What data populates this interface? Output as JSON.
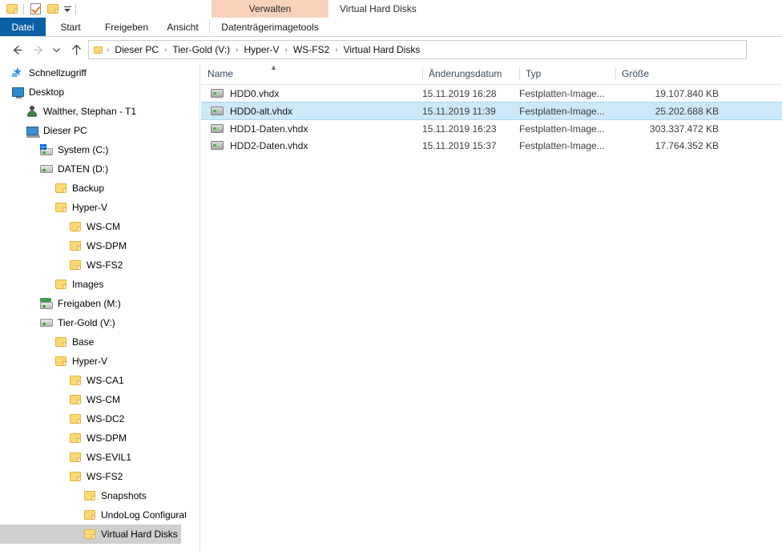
{
  "window": {
    "title": "Virtual Hard Disks",
    "contextual_tab_group": "Verwalten"
  },
  "quick_access_toolbar": {
    "items": [
      {
        "name": "folder-icon",
        "label": ""
      },
      {
        "name": "properties-icon",
        "label": ""
      },
      {
        "name": "new-folder-icon",
        "label": ""
      },
      {
        "name": "customize-dropdown-icon",
        "label": ""
      }
    ]
  },
  "ribbon": {
    "tabs": [
      {
        "id": "file",
        "label": "Datei"
      },
      {
        "id": "start",
        "label": "Start"
      },
      {
        "id": "share",
        "label": "Freigeben"
      },
      {
        "id": "view",
        "label": "Ansicht"
      },
      {
        "id": "disktools",
        "label": "Datenträgerimagetools"
      }
    ],
    "active_tab": "Datei"
  },
  "navigation": {
    "back_label": "Zurück",
    "forward_label": "Vorwärts",
    "recent_label": "Zuletzt besuchte Orte",
    "up_label": "Nach oben",
    "breadcrumb": [
      "Dieser PC",
      "Tier-Gold (V:)",
      "Hyper-V",
      "WS-FS2",
      "Virtual Hard Disks"
    ],
    "separator": "›"
  },
  "sidebar": {
    "items": [
      {
        "label": "Schnellzugriff",
        "icon": "star-icon",
        "indent": 0,
        "selected": false
      },
      {
        "label": "Desktop",
        "icon": "desktop-icon",
        "indent": 0,
        "selected": false
      },
      {
        "label": "Walther, Stephan - T1",
        "icon": "user-icon",
        "indent": 1,
        "selected": false
      },
      {
        "label": "Dieser PC",
        "icon": "pc-icon",
        "indent": 1,
        "selected": false
      },
      {
        "label": "System (C:)",
        "icon": "system-drive-icon",
        "indent": 2,
        "selected": false
      },
      {
        "label": "DATEN (D:)",
        "icon": "drive-icon",
        "indent": 2,
        "selected": false
      },
      {
        "label": "Backup",
        "icon": "folder-icon",
        "indent": 3,
        "selected": false
      },
      {
        "label": "Hyper-V",
        "icon": "folder-icon",
        "indent": 3,
        "selected": false
      },
      {
        "label": "WS-CM",
        "icon": "folder-icon",
        "indent": 4,
        "selected": false
      },
      {
        "label": "WS-DPM",
        "icon": "folder-icon",
        "indent": 4,
        "selected": false
      },
      {
        "label": "WS-FS2",
        "icon": "folder-icon",
        "indent": 4,
        "selected": false
      },
      {
        "label": "Images",
        "icon": "folder-icon",
        "indent": 3,
        "selected": false
      },
      {
        "label": "Freigaben (M:)",
        "icon": "network-drive-icon",
        "indent": 2,
        "selected": false
      },
      {
        "label": "Tier-Gold (V:)",
        "icon": "drive-icon",
        "indent": 2,
        "selected": false
      },
      {
        "label": "Base",
        "icon": "folder-icon",
        "indent": 3,
        "selected": false
      },
      {
        "label": "Hyper-V",
        "icon": "folder-icon",
        "indent": 3,
        "selected": false
      },
      {
        "label": "WS-CA1",
        "icon": "folder-icon",
        "indent": 4,
        "selected": false
      },
      {
        "label": "WS-CM",
        "icon": "folder-icon",
        "indent": 4,
        "selected": false
      },
      {
        "label": "WS-DC2",
        "icon": "folder-icon",
        "indent": 4,
        "selected": false
      },
      {
        "label": "WS-DPM",
        "icon": "folder-icon",
        "indent": 4,
        "selected": false
      },
      {
        "label": "WS-EVIL1",
        "icon": "folder-icon",
        "indent": 4,
        "selected": false
      },
      {
        "label": "WS-FS2",
        "icon": "folder-icon",
        "indent": 4,
        "selected": false
      },
      {
        "label": "Snapshots",
        "icon": "folder-icon",
        "indent": 5,
        "selected": false
      },
      {
        "label": "UndoLog Configuration",
        "icon": "folder-icon",
        "indent": 5,
        "selected": false
      },
      {
        "label": "Virtual Hard Disks",
        "icon": "folder-icon",
        "indent": 5,
        "selected": true
      }
    ]
  },
  "file_list": {
    "columns": [
      {
        "key": "name",
        "label": "Name",
        "sorted": "asc"
      },
      {
        "key": "date",
        "label": "Änderungsdatum",
        "sorted": null
      },
      {
        "key": "type",
        "label": "Typ",
        "sorted": null
      },
      {
        "key": "size",
        "label": "Größe",
        "sorted": null
      }
    ],
    "rows": [
      {
        "name": "HDD0.vhdx",
        "date": "15.11.2019 16:28",
        "type": "Festplatten-Image...",
        "size": "19.107.840 KB",
        "icon": "vhd-icon",
        "selected": false
      },
      {
        "name": "HDD0-alt.vhdx",
        "date": "15.11.2019 11:39",
        "type": "Festplatten-Image...",
        "size": "25.202.688 KB",
        "icon": "vhd-icon",
        "selected": true
      },
      {
        "name": "HDD1-Daten.vhdx",
        "date": "15.11.2019 16:23",
        "type": "Festplatten-Image...",
        "size": "303.337.472 KB",
        "icon": "vhd-icon",
        "selected": false
      },
      {
        "name": "HDD2-Daten.vhdx",
        "date": "15.11.2019 15:37",
        "type": "Festplatten-Image...",
        "size": "17.764.352 KB",
        "icon": "vhd-icon",
        "selected": false
      }
    ]
  },
  "colors": {
    "file_tab": "#0b5fa5",
    "contextual_tab": "#fad2bb",
    "selection": "#cce8f9",
    "tree_selection": "#cfcfcf",
    "folder": "#fcd975"
  }
}
